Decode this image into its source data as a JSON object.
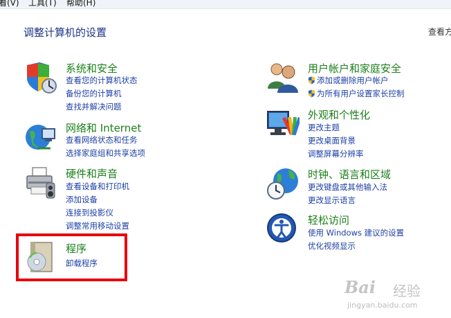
{
  "menubar": {
    "items": [
      "看(V)",
      "工具(T)",
      "帮助(H)"
    ]
  },
  "page_title": "调整计算机的设置",
  "view_by": "查看方式",
  "left_categories": [
    {
      "title": "系统和安全",
      "icon": "system-security-icon",
      "links": [
        "查看您的计算机状态",
        "备份您的计算机",
        "查找并解决问题"
      ]
    },
    {
      "title": "网络和 Internet",
      "icon": "network-icon",
      "links": [
        "查看网络状态和任务",
        "选择家庭组和共享选项"
      ]
    },
    {
      "title": "硬件和声音",
      "icon": "printer-icon",
      "links": [
        "查看设备和打印机",
        "添加设备",
        "连接到投影仪",
        "调整常用移动设置"
      ]
    },
    {
      "title": "程序",
      "icon": "programs-icon",
      "links": [
        "卸载程序"
      ]
    }
  ],
  "right_categories": [
    {
      "title": "用户帐户和家庭安全",
      "icon": "users-icon",
      "links": [
        "添加或删除用户帐户",
        "为所有用户设置家长控制"
      ]
    },
    {
      "title": "外观和个性化",
      "icon": "appearance-icon",
      "links": [
        "更改主题",
        "更改桌面背景",
        "调整屏幕分辨率"
      ]
    },
    {
      "title": "时钟、语言和区域",
      "icon": "clock-globe-icon",
      "links": [
        "更改键盘或其他输入法",
        "更改显示语言"
      ]
    },
    {
      "title": "轻松访问",
      "icon": "ease-of-access-icon",
      "links": [
        "使用 Windows 建议的设置",
        "优化视频显示"
      ]
    }
  ],
  "watermark": {
    "brand": "Bai",
    "brand2": "经验",
    "url": "jingyan.baidu.com"
  },
  "colors": {
    "title_green": "#1a7f1a",
    "link_blue": "#1d3fa5",
    "heading_blue": "#1e3287",
    "highlight_red": "#e8000b"
  }
}
